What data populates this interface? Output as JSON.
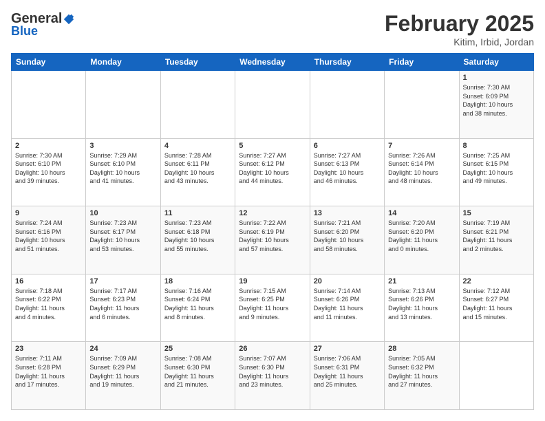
{
  "header": {
    "logo_general": "General",
    "logo_blue": "Blue",
    "month_title": "February 2025",
    "location": "Kitim, Irbid, Jordan"
  },
  "weekdays": [
    "Sunday",
    "Monday",
    "Tuesday",
    "Wednesday",
    "Thursday",
    "Friday",
    "Saturday"
  ],
  "weeks": [
    [
      {
        "day": "",
        "info": ""
      },
      {
        "day": "",
        "info": ""
      },
      {
        "day": "",
        "info": ""
      },
      {
        "day": "",
        "info": ""
      },
      {
        "day": "",
        "info": ""
      },
      {
        "day": "",
        "info": ""
      },
      {
        "day": "1",
        "info": "Sunrise: 7:30 AM\nSunset: 6:09 PM\nDaylight: 10 hours\nand 38 minutes."
      }
    ],
    [
      {
        "day": "2",
        "info": "Sunrise: 7:30 AM\nSunset: 6:10 PM\nDaylight: 10 hours\nand 39 minutes."
      },
      {
        "day": "3",
        "info": "Sunrise: 7:29 AM\nSunset: 6:10 PM\nDaylight: 10 hours\nand 41 minutes."
      },
      {
        "day": "4",
        "info": "Sunrise: 7:28 AM\nSunset: 6:11 PM\nDaylight: 10 hours\nand 43 minutes."
      },
      {
        "day": "5",
        "info": "Sunrise: 7:27 AM\nSunset: 6:12 PM\nDaylight: 10 hours\nand 44 minutes."
      },
      {
        "day": "6",
        "info": "Sunrise: 7:27 AM\nSunset: 6:13 PM\nDaylight: 10 hours\nand 46 minutes."
      },
      {
        "day": "7",
        "info": "Sunrise: 7:26 AM\nSunset: 6:14 PM\nDaylight: 10 hours\nand 48 minutes."
      },
      {
        "day": "8",
        "info": "Sunrise: 7:25 AM\nSunset: 6:15 PM\nDaylight: 10 hours\nand 49 minutes."
      }
    ],
    [
      {
        "day": "9",
        "info": "Sunrise: 7:24 AM\nSunset: 6:16 PM\nDaylight: 10 hours\nand 51 minutes."
      },
      {
        "day": "10",
        "info": "Sunrise: 7:23 AM\nSunset: 6:17 PM\nDaylight: 10 hours\nand 53 minutes."
      },
      {
        "day": "11",
        "info": "Sunrise: 7:23 AM\nSunset: 6:18 PM\nDaylight: 10 hours\nand 55 minutes."
      },
      {
        "day": "12",
        "info": "Sunrise: 7:22 AM\nSunset: 6:19 PM\nDaylight: 10 hours\nand 57 minutes."
      },
      {
        "day": "13",
        "info": "Sunrise: 7:21 AM\nSunset: 6:20 PM\nDaylight: 10 hours\nand 58 minutes."
      },
      {
        "day": "14",
        "info": "Sunrise: 7:20 AM\nSunset: 6:20 PM\nDaylight: 11 hours\nand 0 minutes."
      },
      {
        "day": "15",
        "info": "Sunrise: 7:19 AM\nSunset: 6:21 PM\nDaylight: 11 hours\nand 2 minutes."
      }
    ],
    [
      {
        "day": "16",
        "info": "Sunrise: 7:18 AM\nSunset: 6:22 PM\nDaylight: 11 hours\nand 4 minutes."
      },
      {
        "day": "17",
        "info": "Sunrise: 7:17 AM\nSunset: 6:23 PM\nDaylight: 11 hours\nand 6 minutes."
      },
      {
        "day": "18",
        "info": "Sunrise: 7:16 AM\nSunset: 6:24 PM\nDaylight: 11 hours\nand 8 minutes."
      },
      {
        "day": "19",
        "info": "Sunrise: 7:15 AM\nSunset: 6:25 PM\nDaylight: 11 hours\nand 9 minutes."
      },
      {
        "day": "20",
        "info": "Sunrise: 7:14 AM\nSunset: 6:26 PM\nDaylight: 11 hours\nand 11 minutes."
      },
      {
        "day": "21",
        "info": "Sunrise: 7:13 AM\nSunset: 6:26 PM\nDaylight: 11 hours\nand 13 minutes."
      },
      {
        "day": "22",
        "info": "Sunrise: 7:12 AM\nSunset: 6:27 PM\nDaylight: 11 hours\nand 15 minutes."
      }
    ],
    [
      {
        "day": "23",
        "info": "Sunrise: 7:11 AM\nSunset: 6:28 PM\nDaylight: 11 hours\nand 17 minutes."
      },
      {
        "day": "24",
        "info": "Sunrise: 7:09 AM\nSunset: 6:29 PM\nDaylight: 11 hours\nand 19 minutes."
      },
      {
        "day": "25",
        "info": "Sunrise: 7:08 AM\nSunset: 6:30 PM\nDaylight: 11 hours\nand 21 minutes."
      },
      {
        "day": "26",
        "info": "Sunrise: 7:07 AM\nSunset: 6:30 PM\nDaylight: 11 hours\nand 23 minutes."
      },
      {
        "day": "27",
        "info": "Sunrise: 7:06 AM\nSunset: 6:31 PM\nDaylight: 11 hours\nand 25 minutes."
      },
      {
        "day": "28",
        "info": "Sunrise: 7:05 AM\nSunset: 6:32 PM\nDaylight: 11 hours\nand 27 minutes."
      },
      {
        "day": "",
        "info": ""
      }
    ]
  ]
}
